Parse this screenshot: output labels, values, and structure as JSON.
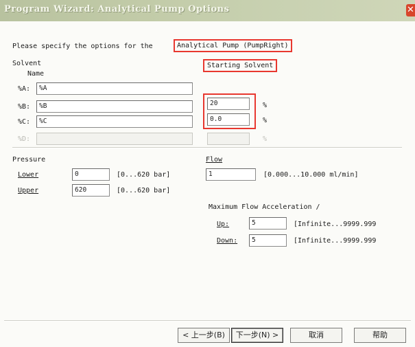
{
  "window": {
    "title": "Program Wizard: Analytical Pump Options",
    "close_glyph": "✕"
  },
  "intro": {
    "text": "Please specify the options for the",
    "pump_name": "Analytical Pump (PumpRight)"
  },
  "solvent": {
    "section_label": "Solvent",
    "name_header": "Name",
    "starting_header": "Starting Solvent",
    "percent_unit": "%",
    "rows": [
      {
        "label": "%A:",
        "name": "%A",
        "percent": "",
        "enabled": true
      },
      {
        "label": "%B:",
        "name": "%B",
        "percent": "20",
        "enabled": true
      },
      {
        "label": "%C:",
        "name": "%C",
        "percent": "0.0",
        "enabled": true
      },
      {
        "label": "%D:",
        "name": "",
        "percent": "",
        "enabled": false
      }
    ]
  },
  "pressure": {
    "section_label": "Pressure",
    "lower_label": "Lower",
    "lower_value": "0",
    "lower_range": "[0...620 bar]",
    "upper_label": "Upper",
    "upper_value": "620",
    "upper_range": "[0...620 bar]"
  },
  "flow": {
    "section_label": "Flow",
    "value": "1",
    "range": "[0.000...10.000 ml/min]",
    "accel_label": "Maximum Flow Acceleration /",
    "up_label": "Up:",
    "up_value": "5",
    "up_range": "[Infinite...9999.999",
    "down_label": "Down:",
    "down_value": "5",
    "down_range": "[Infinite...9999.999"
  },
  "buttons": {
    "back": "< 上一步(B)",
    "next": "下一步(N) >",
    "cancel": "取消",
    "help": "帮助"
  }
}
